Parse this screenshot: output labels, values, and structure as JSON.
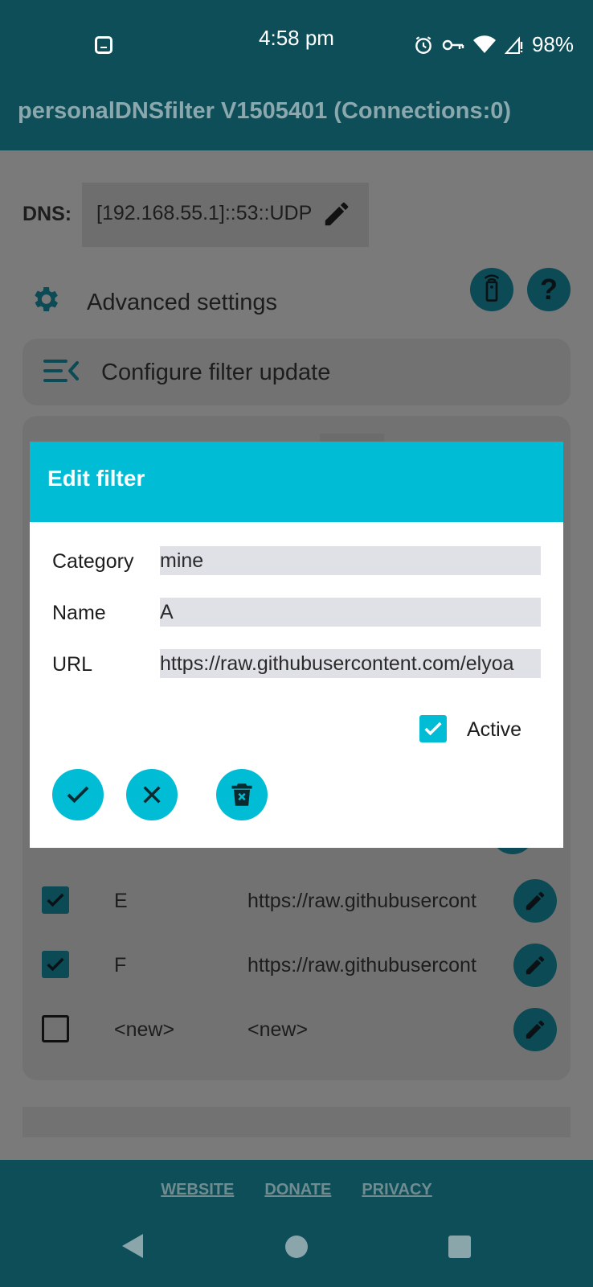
{
  "status_bar": {
    "time": "4:58 pm",
    "battery": "98%",
    "icons": [
      "notification-app-icon",
      "alarm-icon",
      "vpn-key-icon",
      "wifi-icon",
      "signal-icon",
      "battery-icon"
    ]
  },
  "app": {
    "title": "personalDNSfilter V1505401 (Connections:0)"
  },
  "dns": {
    "label": "DNS:",
    "value": "[192.168.55.1]::53::UDP"
  },
  "advanced": {
    "label": "Advanced settings"
  },
  "configure": {
    "label": "Configure filter update"
  },
  "filter_list": {
    "rows": [
      {
        "active": true,
        "name": "E",
        "url": "https://raw.githubusercont"
      },
      {
        "active": true,
        "name": "F",
        "url": "https://raw.githubusercont"
      },
      {
        "active": false,
        "name": "<new>",
        "url": "<new>"
      }
    ]
  },
  "dialog": {
    "title": "Edit filter",
    "category_label": "Category",
    "category_value": "mine",
    "name_label": "Name",
    "name_value": "A",
    "url_label": "URL",
    "url_value": "https://raw.githubusercontent.com/elyoa",
    "active_label": "Active",
    "active": true
  },
  "footer": {
    "links": [
      "WEBSITE",
      "DONATE",
      "PRIVACY"
    ]
  },
  "colors": {
    "teal_dark": "#0d4e58",
    "accent": "#00bcd4",
    "overlay_gray": "#7a7a7a"
  }
}
